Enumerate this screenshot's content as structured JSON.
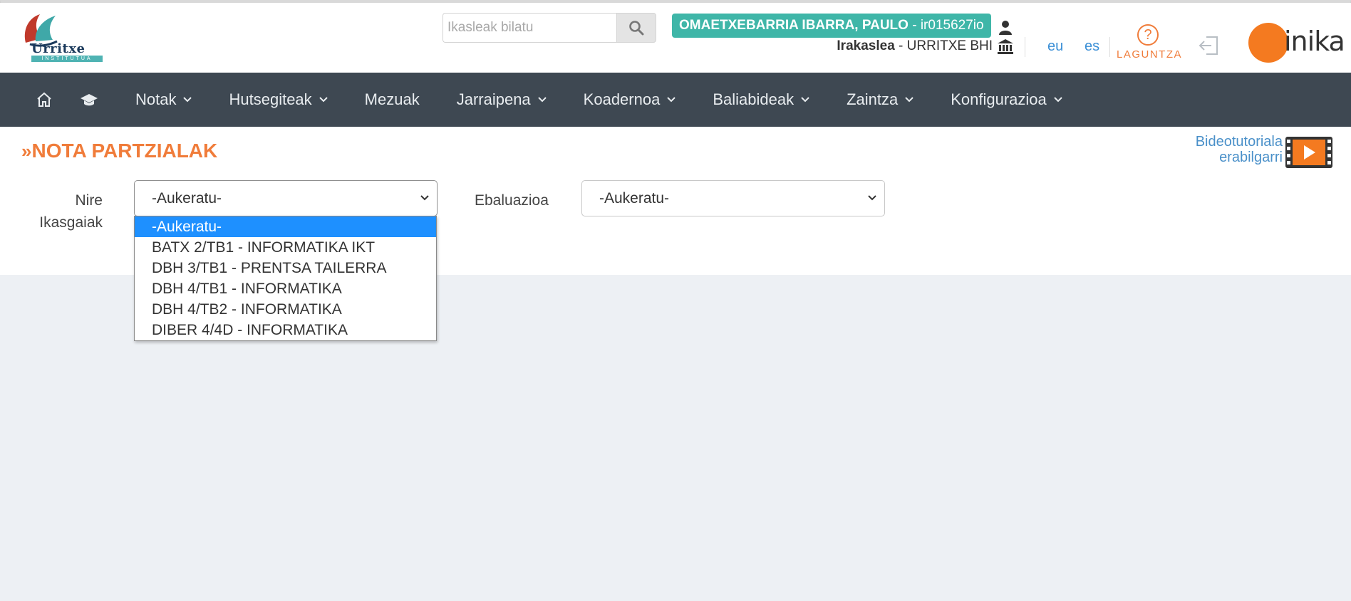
{
  "header": {
    "logo_name": "Urritxe",
    "logo_sub": "INSTITUTUA",
    "search": {
      "placeholder": "Ikasleak bilatu"
    },
    "user": {
      "name": "OMAETXEBARRIA IBARRA, PAULO",
      "id": " - ir015627io"
    },
    "role": {
      "title": "Irakaslea",
      "school": " - URRITXE BHI"
    },
    "languages": [
      "eu",
      "es"
    ],
    "help_label": "LAGUNTZA",
    "brand": "inika"
  },
  "navbar": {
    "items": [
      {
        "label": "Notak",
        "dropdown": true
      },
      {
        "label": "Hutsegiteak",
        "dropdown": true
      },
      {
        "label": "Mezuak",
        "dropdown": false
      },
      {
        "label": "Jarraipena",
        "dropdown": true
      },
      {
        "label": "Koadernoa",
        "dropdown": true
      },
      {
        "label": "Baliabideak",
        "dropdown": true
      },
      {
        "label": "Zaintza",
        "dropdown": true
      },
      {
        "label": "Konfigurazioa",
        "dropdown": true
      }
    ]
  },
  "main": {
    "title_prefix": "»",
    "title": "NOTA PARTZIALAK",
    "video_link_line1": "Bideotutoriala",
    "video_link_line2": "erabilgarri",
    "subjects_label_line1": "Nire",
    "subjects_label_line2": "Ikasgaiak",
    "subjects_selected": "-Aukeratu-",
    "eval_label": "Ebaluazioa",
    "eval_selected": "-Aukeratu-",
    "subjects_options": [
      "-Aukeratu-",
      "BATX 2/TB1 - INFORMATIKA IKT",
      "DBH 3/TB1 - PRENTSA TAILERRA",
      "DBH 4/TB1 - INFORMATIKA",
      "DBH 4/TB2 - INFORMATIKA",
      "DIBER 4/4D - INFORMATIKA"
    ],
    "subjects_highlighted_index": 0
  },
  "colors": {
    "accent_orange": "#f07c3a",
    "navbar_bg": "#3e4852",
    "user_badge": "#3fb6a8",
    "link_blue": "#3b8fd6",
    "option_highlight": "#1e90ff"
  }
}
